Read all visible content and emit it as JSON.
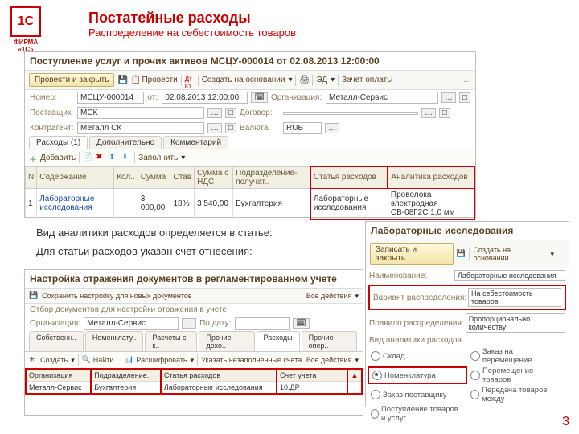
{
  "logo": {
    "mark": "1C",
    "firm": "ФИРМА «1С»"
  },
  "title": {
    "t1": "Постатейные расходы",
    "t2": "Распределение на себестоимость товаров"
  },
  "win1": {
    "header": "Поступление услуг и прочих активов МСЦУ-000014 от 02.08.2013 12:00:00",
    "tb": {
      "post": "Провести и закрыть",
      "prov": "Провести",
      "create": "Создать на основании",
      "ed": "ЭД",
      "offset": "Зачет оплаты"
    },
    "f": {
      "numL": "Номер:",
      "numV": "МСЦУ-000014",
      "fromL": "от:",
      "fromV": "02.08.2013 12:00:00",
      "orgL": "Организация:",
      "orgV": "Металл-Сервис",
      "supL": "Поставщик:",
      "supV": "МСК",
      "conL": "Договор:",
      "conV": "",
      "agL": "Контрагент:",
      "agV": "Металл СК",
      "curL": "Валюта:",
      "curV": "RUB"
    },
    "tabs": {
      "t1": "Расходы (1)",
      "t2": "Дополнительно",
      "t3": "Комментарий"
    },
    "tb2": {
      "add": "Добавить",
      "fill": "Заполнить"
    },
    "cols": {
      "n": "N",
      "desc": "Содержание",
      "qty": "Кол..",
      "sum": "Сумма",
      "rate": "Став",
      "sumvat": "Сумма с НДС",
      "dep": "Подразделение-получат..",
      "acc": "Статья расходов",
      "anal": "Аналитика расходов"
    },
    "row": {
      "n": "1",
      "desc": "Лабораторные исследования",
      "qty": "",
      "sum": "3 000,00",
      "rate": "18%",
      "sumvat": "3 540,00",
      "dep": "Бухгалтерия",
      "acc": "Лабораторные исследования",
      "anal": "Проволока электродная СВ-08Г2С 1,0 мм"
    }
  },
  "notes": {
    "l1": "Вид аналитики расходов определяется в статье:",
    "l2": "Для статьи расходов указан счет отнесения:"
  },
  "win2": {
    "header": "Лабораторные исследования",
    "tb": {
      "save": "Записать и закрыть",
      "create": "Создать на основании"
    },
    "nameL": "Наименование:",
    "nameV": "Лабораторные исследования",
    "varL": "Вариант распределения:",
    "varV": "На себестоимость товаров",
    "ruleL": "Правило распределения:",
    "ruleV": "Пропорционально количеству",
    "analL": "Вид аналитики расходов",
    "r": {
      "sklad": "Склад",
      "nomen": "Номенклатура",
      "zakazP": "Заказ поставщику",
      "postup": "Поступление товаров и услуг",
      "zakazPer": "Заказ на перемещение",
      "perem": "Перемещение товаров",
      "pered": "Передача товаров между"
    }
  },
  "win3": {
    "header": "Настройка отражения документов в регламентированном учете",
    "tb": {
      "save": "Сохранить настройку для новых документов",
      "all": "Все действия"
    },
    "selL": "Отбор документов для настройки отражения в учете:",
    "orgL": "Организация:",
    "orgV": "Металл-Сервис",
    "dateL": "По дату:",
    "dateV": ". .",
    "tabs": {
      "t1": "Собственн..",
      "t2": "Номенклату..",
      "t3": "Расчеты с к..",
      "t4": "Прочие дохо..",
      "t5": "Расходы",
      "t6": "Прочие опер.."
    },
    "tb2": {
      "create": "Создать",
      "find": "Найти..",
      "dec": "Расшифровать",
      "unfilled": "Указать незаполненные счета",
      "all": "Все действия"
    },
    "cols": {
      "org": "Организация",
      "dep": "Подразделение..",
      "stat": "Статья расходов",
      "acc": "Счет учета"
    },
    "row": {
      "org": "Металл-Сервис",
      "dep": "Бухгалтерия",
      "stat": "Лабораторные исследования",
      "acc": "10.ДР"
    }
  },
  "pagenum": "3"
}
